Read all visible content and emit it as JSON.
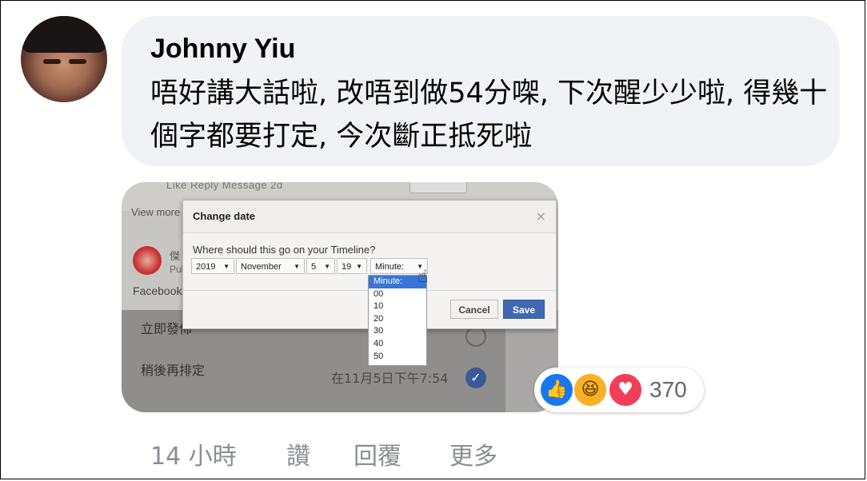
{
  "comment": {
    "author": "Johnny Yiu",
    "text": "唔好講大話啦, 改唔到做54分㗎, 下次醒少少啦, 得幾十個字都要打定, 今次斷正抵死啦"
  },
  "photo": {
    "top_bar_text": "Like   Reply   Message   2d",
    "view_more": "View more",
    "poster_name": "傑",
    "poster_sub": "Pub",
    "facebook_label": "Facebook",
    "option_now": "立即發佈",
    "option_later": "稍後再排定",
    "scheduled_time": "在11月5日下午7:54",
    "dialog": {
      "title": "Change date",
      "question": "Where should this go on your Timeline?",
      "year": "2019",
      "month": "November",
      "day": "5",
      "hour": "19",
      "minute": "Minute:",
      "cancel": "Cancel",
      "save": "Save",
      "minute_options": [
        "Minute:",
        "00",
        "10",
        "20",
        "30",
        "40",
        "50"
      ]
    }
  },
  "reactions": {
    "types": [
      "like-icon",
      "haha-icon",
      "love-icon"
    ],
    "count": "370"
  },
  "actions": {
    "time": "14 小時",
    "like": "讚",
    "reply": "回覆",
    "more": "更多"
  }
}
